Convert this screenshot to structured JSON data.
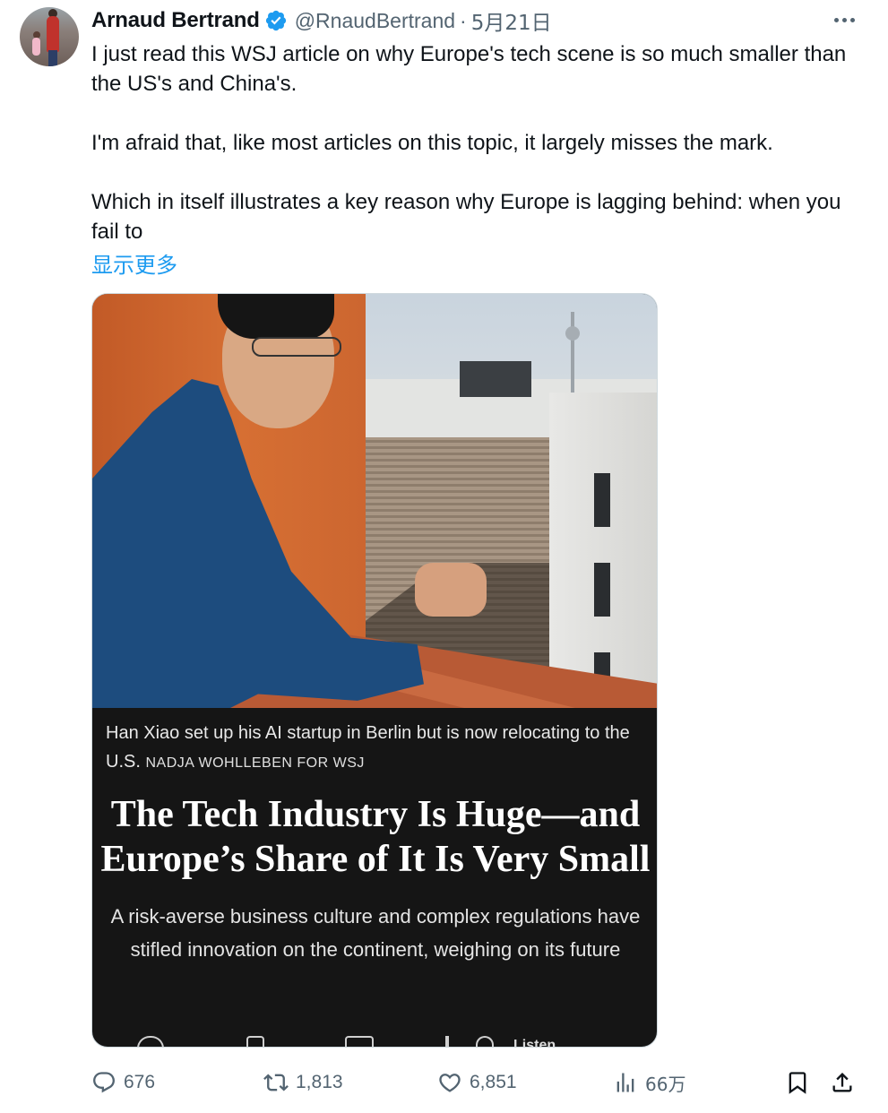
{
  "author": {
    "display_name": "Arnaud Bertrand",
    "handle": "@RnaudBertrand",
    "separator": "·",
    "date": "5月21日",
    "verified": true
  },
  "tweet": {
    "paragraphs": [
      "I just read this WSJ article on why Europe's tech scene is so much smaller than the US's and China's.",
      "I'm afraid that, like most articles on this topic, it largely misses the mark.",
      "Which in itself illustrates a key reason why Europe is lagging behind: when you fail to"
    ],
    "show_more": "显示更多"
  },
  "media": {
    "caption": "Han Xiao set up his AI startup in Berlin but is now relocating to the U.S.",
    "credit": "NADJA WOHLLEBEN FOR WSJ",
    "headline": "The Tech Industry Is Huge—and Europe’s Share of It Is Very Small",
    "dek": "A risk-averse business culture and complex regulations have stifled innovation on the continent, weighing on its future",
    "toolbar_label": "Listen"
  },
  "metrics": {
    "replies": "676",
    "retweets": "1,813",
    "likes": "6,851",
    "views": "66万"
  },
  "icons": {
    "reply": "reply-icon",
    "retweet": "retweet-icon",
    "like": "heart-icon",
    "views": "views-icon",
    "bookmark": "bookmark-icon",
    "share": "share-icon",
    "more": "more-icon",
    "verified": "verified-badge-icon"
  },
  "colors": {
    "text": "#0f1419",
    "secondary": "#536471",
    "link": "#1d9bf0",
    "verified": "#1d9bf0",
    "media_bg": "#151515"
  }
}
